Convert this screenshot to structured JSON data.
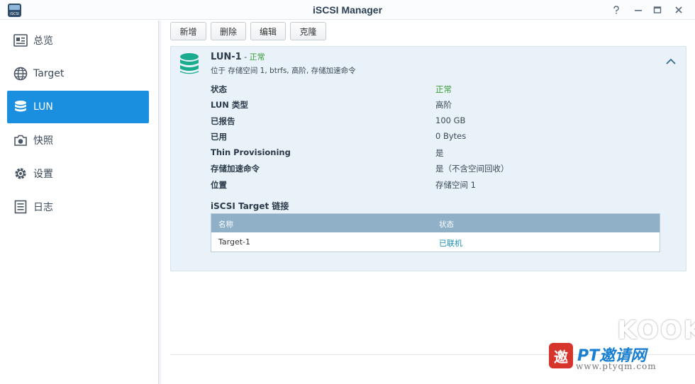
{
  "window": {
    "title": "iSCSI Manager",
    "icon_label": "iSCSI",
    "controls": [
      "help-icon",
      "minimize-icon",
      "maximize-icon",
      "close-icon"
    ]
  },
  "sidebar": {
    "items": [
      {
        "label": "总览",
        "icon": "overview-card-icon",
        "active": false
      },
      {
        "label": "Target",
        "icon": "globe-icon",
        "active": false
      },
      {
        "label": "LUN",
        "icon": "database-icon",
        "active": true
      },
      {
        "label": "快照",
        "icon": "camera-icon",
        "active": false
      },
      {
        "label": "设置",
        "icon": "gear-icon",
        "active": false
      },
      {
        "label": "日志",
        "icon": "log-list-icon",
        "active": false
      }
    ]
  },
  "toolbar": {
    "create": "新增",
    "delete": "删除",
    "edit": "编辑",
    "clone": "克隆"
  },
  "lun": {
    "name": "LUN-1",
    "separator": " - ",
    "status": "正常",
    "subtitle": "位于 存储空间 1, btrfs, 高阶, 存储加速命令",
    "details": [
      {
        "label": "状态",
        "value": "正常"
      },
      {
        "label": "LUN 类型",
        "value": "高阶"
      },
      {
        "label": "已报告",
        "value": "100 GB"
      },
      {
        "label": "已用",
        "value": "0 Bytes"
      },
      {
        "label": "Thin Provisioning",
        "value": "是"
      },
      {
        "label": "存储加速命令",
        "value": "是（不含空间回收）"
      },
      {
        "label": "位置",
        "value": "存储空间 1"
      }
    ],
    "links_title": "iSCSI Target 链接",
    "links_table": {
      "columns": [
        "名称",
        "状态"
      ],
      "rows": [
        {
          "name": "Target-1",
          "status": "已联机"
        }
      ]
    }
  },
  "colors": {
    "accent": "#1a8fe0",
    "ok": "#3a9b3a",
    "panel_bg": "#e8f2f8",
    "table_header": "#8fb0c7",
    "lun_icon": "#1bab8e"
  },
  "watermark": {
    "brand": "KOOK",
    "logo_char": "邀",
    "text": "PT邀请网",
    "url": "www.ptyqm.com"
  }
}
